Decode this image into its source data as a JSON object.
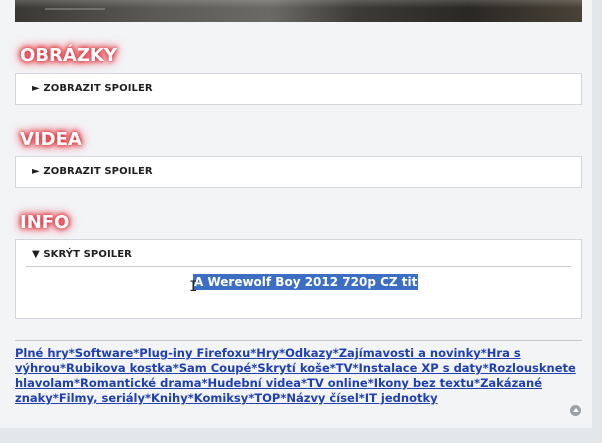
{
  "sections": [
    {
      "heading": "OBRÁZKY",
      "toggle": "► ZOBRAZIT SPOILER"
    },
    {
      "heading": "VIDEA",
      "toggle": "► ZOBRAZIT SPOILER"
    },
    {
      "heading": "INFO",
      "toggle": "▼ SKRÝT SPOILER",
      "content": "A Werewolf Boy 2012 720p CZ tit"
    }
  ],
  "cursor_glyph": "I",
  "footer_links": [
    "Plné hry",
    "Software",
    "Plug-iny Firefoxu",
    "Hry",
    "Odkazy",
    "Zajímavosti a novinky",
    "Hra s výhrou",
    "Rubikova kostka",
    "Sam Coupé",
    "Skrytí koše",
    "TV",
    "Instalace XP s daty",
    "Rozlousknete hlavolam",
    "Romantické drama",
    "Hudební videa",
    "TV online",
    "Ikony bez textu",
    "Zakázané znaky",
    "Filmy, seriály",
    "Knihy",
    "Komiksy",
    "TOP",
    "Názvy čísel",
    "IT jednotky"
  ],
  "footer_separator": "*",
  "colors": {
    "heading_glow": "#e0323c",
    "link": "#1f3fb3",
    "selection": "#3c6fc4"
  },
  "icons": {
    "back_to_top": "arrow-up-circle-icon"
  }
}
